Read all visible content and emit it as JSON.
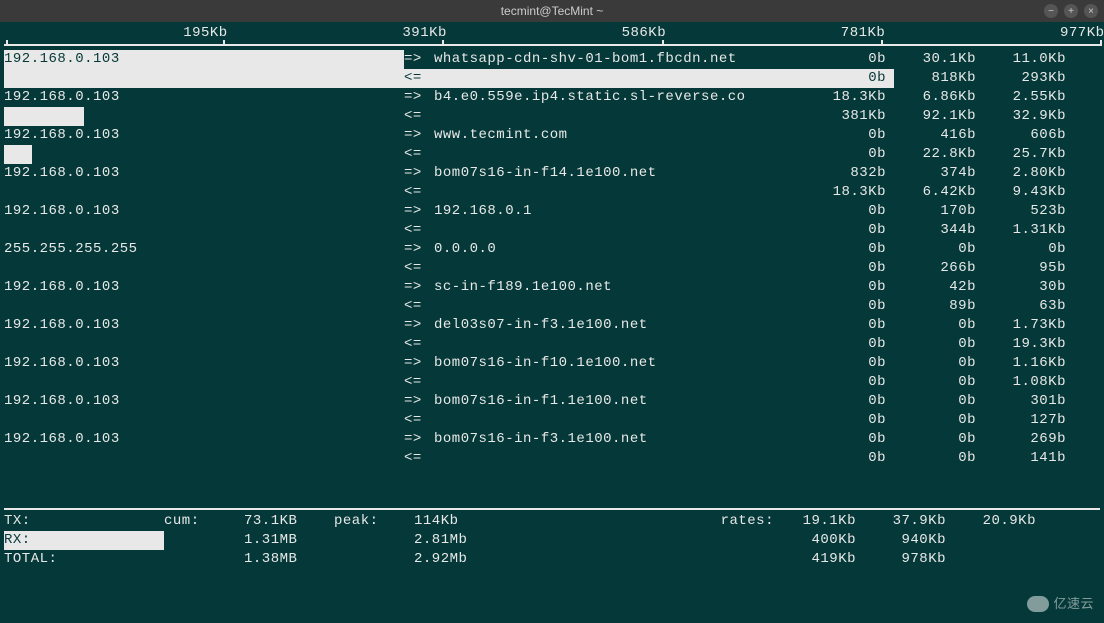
{
  "window": {
    "title": "tecmint@TecMint ~"
  },
  "scale": {
    "ticks": [
      "195Kb",
      "391Kb",
      "586Kb",
      "781Kb",
      "977Kb"
    ]
  },
  "connections": [
    {
      "src": "192.168.0.103",
      "dst": "whatsapp-cdn-shv-01-bom1.fbcdn.net",
      "tx": {
        "c1": "0b",
        "c2": "30.1Kb",
        "c3": "11.0Kb"
      },
      "rx": {
        "c1": "0b",
        "c2": "818Kb",
        "c3": "293Kb"
      },
      "hl_tx_src": true,
      "hl_rx_full": true
    },
    {
      "src": "192.168.0.103",
      "dst": "b4.e0.559e.ip4.static.sl-reverse.co",
      "tx": {
        "c1": "18.3Kb",
        "c2": "6.86Kb",
        "c3": "2.55Kb"
      },
      "rx": {
        "c1": "381Kb",
        "c2": "92.1Kb",
        "c3": "32.9Kb"
      },
      "rx_white_box": true
    },
    {
      "src": "192.168.0.103",
      "dst": "www.tecmint.com",
      "tx": {
        "c1": "0b",
        "c2": "416b",
        "c3": "606b"
      },
      "rx": {
        "c1": "0b",
        "c2": "22.8Kb",
        "c3": "25.7Kb"
      },
      "rx_white_box_small": true
    },
    {
      "src": "192.168.0.103",
      "dst": "bom07s16-in-f14.1e100.net",
      "tx": {
        "c1": "832b",
        "c2": "374b",
        "c3": "2.80Kb"
      },
      "rx": {
        "c1": "18.3Kb",
        "c2": "6.42Kb",
        "c3": "9.43Kb"
      }
    },
    {
      "src": "192.168.0.103",
      "dst": "192.168.0.1",
      "tx": {
        "c1": "0b",
        "c2": "170b",
        "c3": "523b"
      },
      "rx": {
        "c1": "0b",
        "c2": "344b",
        "c3": "1.31Kb"
      }
    },
    {
      "src": "255.255.255.255",
      "dst": "0.0.0.0",
      "tx": {
        "c1": "0b",
        "c2": "0b",
        "c3": "0b"
      },
      "rx": {
        "c1": "0b",
        "c2": "266b",
        "c3": "95b"
      }
    },
    {
      "src": "192.168.0.103",
      "dst": "sc-in-f189.1e100.net",
      "tx": {
        "c1": "0b",
        "c2": "42b",
        "c3": "30b"
      },
      "rx": {
        "c1": "0b",
        "c2": "89b",
        "c3": "63b"
      }
    },
    {
      "src": "192.168.0.103",
      "dst": "del03s07-in-f3.1e100.net",
      "tx": {
        "c1": "0b",
        "c2": "0b",
        "c3": "1.73Kb"
      },
      "rx": {
        "c1": "0b",
        "c2": "0b",
        "c3": "19.3Kb"
      }
    },
    {
      "src": "192.168.0.103",
      "dst": "bom07s16-in-f10.1e100.net",
      "tx": {
        "c1": "0b",
        "c2": "0b",
        "c3": "1.16Kb"
      },
      "rx": {
        "c1": "0b",
        "c2": "0b",
        "c3": "1.08Kb"
      }
    },
    {
      "src": "192.168.0.103",
      "dst": "bom07s16-in-f1.1e100.net",
      "tx": {
        "c1": "0b",
        "c2": "0b",
        "c3": "301b"
      },
      "rx": {
        "c1": "0b",
        "c2": "0b",
        "c3": "127b"
      }
    },
    {
      "src": "192.168.0.103",
      "dst": "bom07s16-in-f3.1e100.net",
      "tx": {
        "c1": "0b",
        "c2": "0b",
        "c3": "269b"
      },
      "rx": {
        "c1": "0b",
        "c2": "0b",
        "c3": "141b"
      }
    }
  ],
  "arrows": {
    "tx": "=>",
    "rx": "<="
  },
  "stats": {
    "labels": {
      "tx": "TX:",
      "rx": "RX:",
      "total": "TOTAL:",
      "cum": "cum:",
      "peak": "peak:",
      "rates": "rates:"
    },
    "tx": {
      "cum": "73.1KB",
      "peak": "114Kb",
      "r1": "19.1Kb",
      "r2": "37.9Kb",
      "r3": "20.9Kb"
    },
    "rx": {
      "cum": "1.31MB",
      "peak": "2.81Mb",
      "r1": "400Kb",
      "r2": "940Kb"
    },
    "total": {
      "cum": "1.38MB",
      "peak": "2.92Mb",
      "r1": "419Kb",
      "r2": "978Kb"
    }
  },
  "watermark": "亿速云"
}
